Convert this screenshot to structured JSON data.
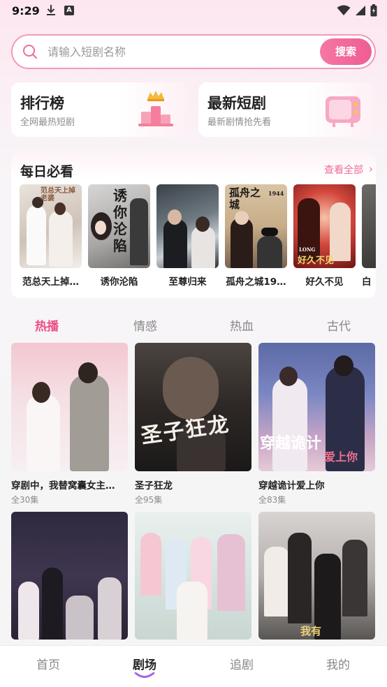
{
  "status": {
    "time": "9:29",
    "a_badge": "A"
  },
  "search": {
    "placeholder": "请输入短剧名称",
    "button": "搜索"
  },
  "cards": [
    {
      "title": "排行榜",
      "subtitle": "全网最热短剧"
    },
    {
      "title": "最新短剧",
      "subtitle": "最新剧情抢先看"
    }
  ],
  "daily": {
    "title": "每日必看",
    "view_all": "查看全部",
    "items": [
      {
        "name": "范总天上掉…",
        "poster_text": "范总天上掉老婆"
      },
      {
        "name": "诱你沦陷",
        "poster_text": "诱你沦陷"
      },
      {
        "name": "至尊归来",
        "poster_text": ""
      },
      {
        "name": "孤舟之城19…",
        "poster_text": "孤舟之城",
        "poster_sub": "1944"
      },
      {
        "name": "好久不见",
        "poster_text": "好久不见",
        "poster_sub": "LONG"
      },
      {
        "name": "白",
        "poster_text": ""
      }
    ]
  },
  "tabs": [
    "热播",
    "情感",
    "热血",
    "古代"
  ],
  "active_tab": "热播",
  "grid": [
    {
      "name": "穿剧中，我替窝囊女主…",
      "eps": "全30集"
    },
    {
      "name": "圣子狂龙",
      "eps": "全95集",
      "poster_text": "圣子狂龙"
    },
    {
      "name": "穿越诡计爱上你",
      "eps": "全83集",
      "poster_text": "穿越诡计",
      "poster_text2": "爱上你"
    },
    {
      "name": "",
      "eps": ""
    },
    {
      "name": "",
      "eps": ""
    },
    {
      "name": "",
      "eps": "",
      "poster_text": "我有"
    }
  ],
  "nav": [
    "首页",
    "剧场",
    "追剧",
    "我的"
  ],
  "active_nav": "剧场",
  "colors": {
    "accent": "#ee4d86",
    "brand_gradient_start": "#f477a3",
    "brand_gradient_end": "#ef5d94"
  }
}
